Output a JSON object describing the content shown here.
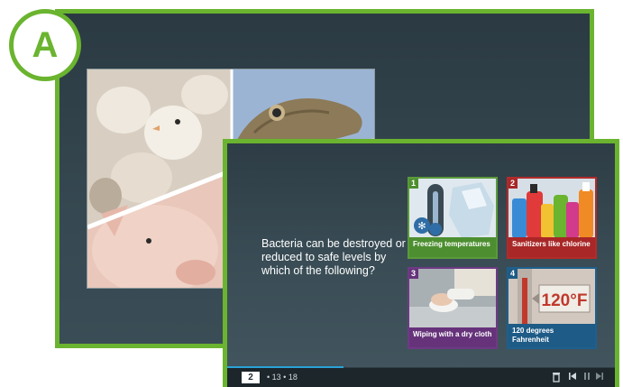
{
  "badge": {
    "letter": "A"
  },
  "colors": {
    "accent": "#6ab42f",
    "progress": "#2aa3d8"
  },
  "collage": {
    "images": [
      "chicks-photo",
      "lizard-photo",
      "pig-photo"
    ]
  },
  "question": {
    "text": "Bacteria can be destroyed or reduced to safe levels by which of the following?"
  },
  "options": [
    {
      "number": "1",
      "label": "Freezing temperatures",
      "image": "frozen-thermometer-ice"
    },
    {
      "number": "2",
      "label": "Sanitizers like chlorine",
      "image": "cleaning-bottles"
    },
    {
      "number": "3",
      "label": "Wiping with a dry cloth",
      "image": "hand-wiping-counter"
    },
    {
      "number": "4",
      "label": "120 degrees Fahrenheit",
      "image": "thermometer-120f",
      "image_text": "120°F"
    }
  ],
  "player": {
    "current_page": "2",
    "other_pages": "• 13 • 18",
    "progress": 0.3,
    "controls": [
      "trash-icon",
      "skip-back-icon",
      "pause-icon",
      "skip-forward-icon"
    ]
  }
}
